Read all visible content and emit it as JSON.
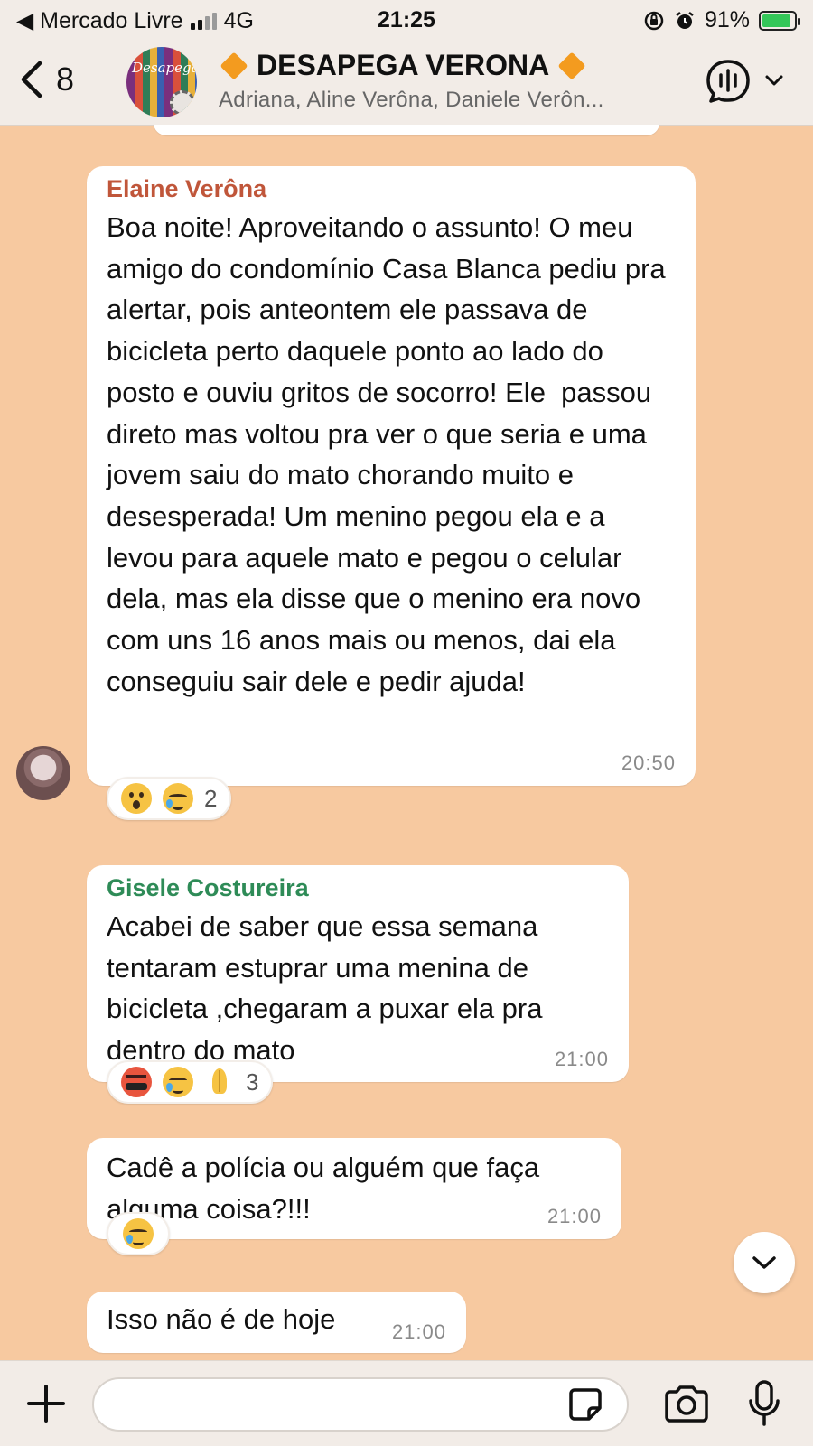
{
  "status_bar": {
    "carrier_back": "◀ Mercado Livre",
    "network": "4G",
    "time": "21:25",
    "battery": "91%",
    "battery_level": 0.91
  },
  "header": {
    "back_count": "8",
    "group_name": "DESAPEGA VERONA",
    "members": "Adriana, Aline Verôna, Daniele Verôn...",
    "avatar_text": "Desapega"
  },
  "messages": [
    {
      "sender": "Elaine Verôna",
      "sender_color": "#c0563a",
      "text": "Boa noite! Aproveitando o assunto! O meu amigo do condomínio Casa Blanca pediu pra alertar, pois anteontem ele passava de bicicleta perto daquele ponto ao lado do posto e ouviu gritos de socorro! Ele  passou direto mas voltou pra ver o que seria e uma jovem saiu do mato chorando muito e desesperada! Um menino pegou ela e a levou para aquele mato e pegou o celular dela, mas ela disse que o menino era novo com uns 16 anos mais ou menos, dai ela conseguiu sair dele e pedir ajuda!",
      "time": "20:50",
      "reactions": {
        "icons": [
          "surprised-face-icon",
          "crying-face-icon"
        ],
        "count": "2"
      }
    },
    {
      "sender": "Gisele Costureira",
      "sender_color": "#2e8b57",
      "text": "Acabei de saber que essa semana tentaram estuprar uma menina de bicicleta ,chegaram a puxar ela pra dentro do mato",
      "time": "21:00",
      "reactions": {
        "icons": [
          "angry-face-icon",
          "crying-face-icon",
          "praying-hands-icon"
        ],
        "count": "3"
      }
    },
    {
      "sender": "",
      "text": "Cadê a polícia ou alguém que faça alguma coisa?!!!",
      "time": "21:00",
      "reactions": {
        "icons": [
          "crying-face-icon"
        ],
        "count": ""
      }
    },
    {
      "sender": "",
      "text": "Isso não é de hoje",
      "time": "21:00"
    }
  ],
  "composer": {
    "placeholder": ""
  },
  "colors": {
    "chat_background": "#f7c9a0",
    "bubble": "#ffffff",
    "bars": "#f2ece7"
  }
}
